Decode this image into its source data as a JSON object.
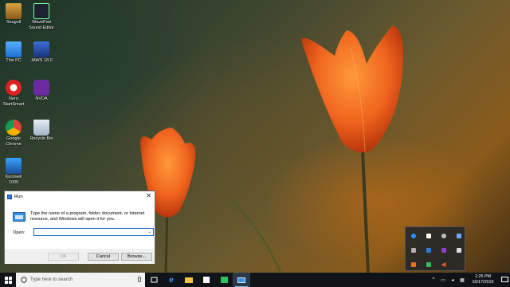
{
  "desktop": {
    "icons": [
      {
        "label": "Seagull"
      },
      {
        "label": "WavePad Sound Editor"
      },
      {
        "label": "This PC"
      },
      {
        "label": "JAWS 18.0"
      },
      {
        "label": "Nero StartSmart"
      },
      {
        "label": "NVDA"
      },
      {
        "label": "Google Chrome"
      },
      {
        "label": "Recycle Bin"
      },
      {
        "label": "Kurzweil 1000"
      }
    ]
  },
  "run_dialog": {
    "title": "Run",
    "close_glyph": "✕",
    "description": "Type the name of a program, folder, document, or Internet resource, and Windows will open it for you.",
    "open_label": "Open:",
    "open_value": "",
    "ok_label": "OK",
    "cancel_label": "Cancel",
    "browse_label": "Browse..."
  },
  "taskbar": {
    "search_placeholder": "Type here to search",
    "time": "1:25 PM",
    "date": "10/17/2019",
    "pinned": [
      "task-view",
      "edge",
      "file-explorer",
      "store",
      "app-green",
      "run-window"
    ]
  },
  "tray_overflow": {
    "icons": [
      "bluetooth-icon",
      "shield-icon",
      "cloud-icon",
      "monitor-icon",
      "document-icon",
      "dropbox-icon",
      "nvda-icon",
      "printer-icon",
      "box-icon",
      "green-app-icon",
      "speaker-icon"
    ]
  },
  "colors": {
    "taskbar": "#101418",
    "accent": "#2b6cc4",
    "tulip": "#f0641e"
  }
}
